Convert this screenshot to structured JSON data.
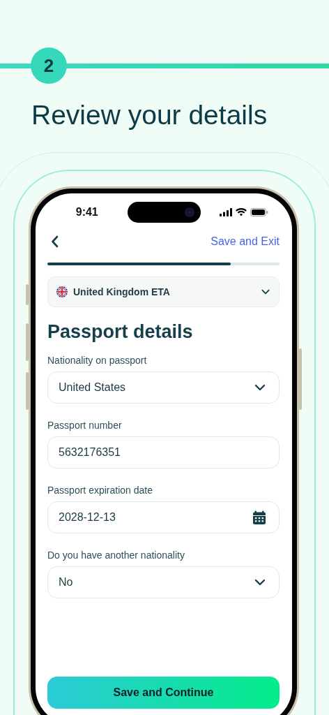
{
  "step": {
    "number": "2"
  },
  "headline": "Review your details",
  "phone": {
    "status_bar": {
      "time": "9:41"
    },
    "nav": {
      "action": "Save and Exit"
    },
    "progress": {
      "level": 0.79
    },
    "visa_selector": {
      "label": "United Kingdom ETA"
    },
    "title": "Passport details",
    "fields": [
      {
        "kind": "select",
        "label": "Nationality on passport",
        "value": "United States"
      },
      {
        "kind": "text",
        "label": "Passport number",
        "value": "5632176351"
      },
      {
        "kind": "date",
        "label": "Passport expiration date",
        "value": "2028-12-13"
      },
      {
        "kind": "select",
        "label": "Do you have another nationality",
        "value": "No"
      }
    ],
    "primary_button": "Save and Continue"
  }
}
